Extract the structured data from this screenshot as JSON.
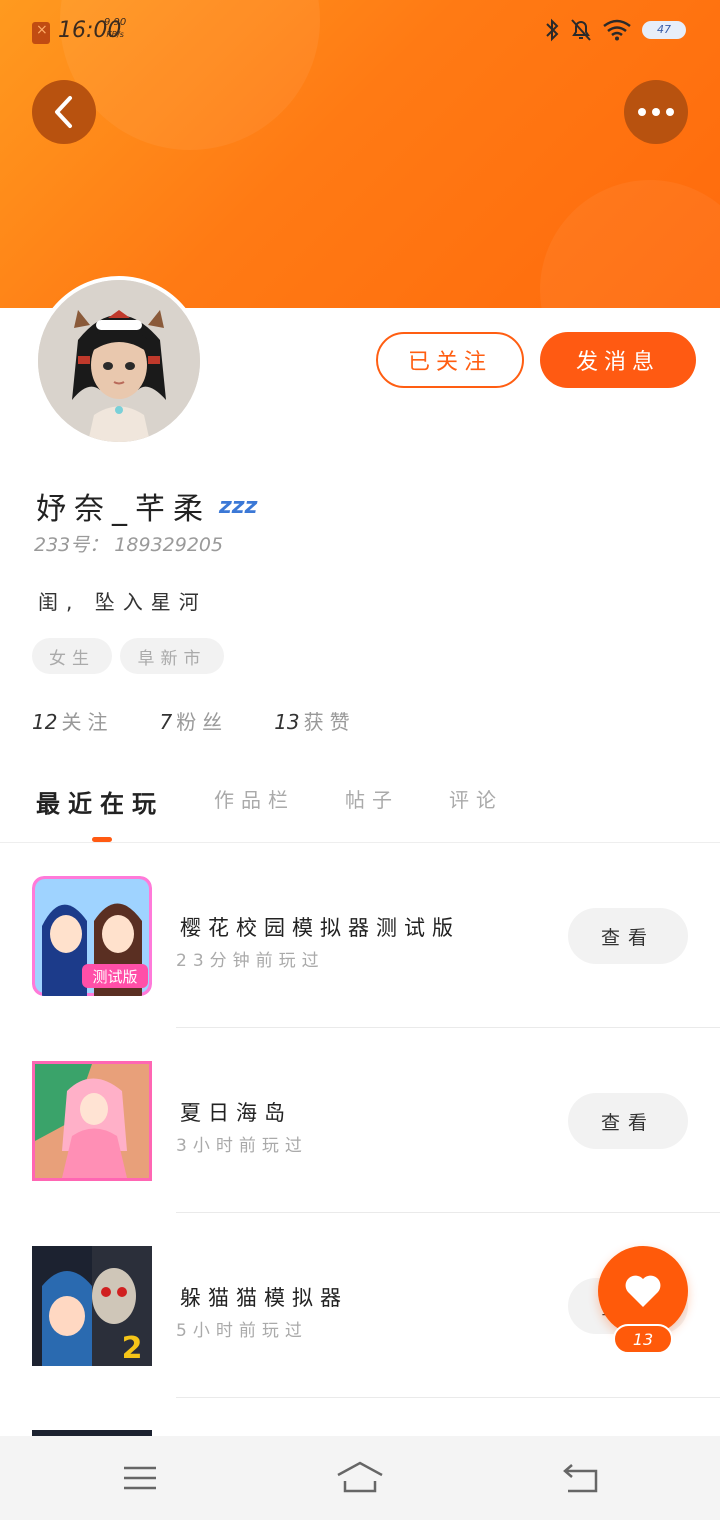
{
  "statusbar": {
    "time": "16:00",
    "speed_value": "9.90",
    "speed_unit": "KB/s",
    "battery": "47"
  },
  "profile": {
    "username": "妤奈_芊柔",
    "zz": "zzz",
    "uid": "233号： 189329205",
    "bio": "闺, 坠入星河",
    "tags": [
      "女生",
      "阜新市"
    ]
  },
  "actions": {
    "follow_label": "已关注",
    "message_label": "发消息"
  },
  "stats": [
    {
      "num": "12",
      "label": "关注"
    },
    {
      "num": "7",
      "label": "粉丝"
    },
    {
      "num": "13",
      "label": "获赞"
    }
  ],
  "tabs": [
    "最近在玩",
    "作品栏",
    "帖子",
    "评论"
  ],
  "games": [
    {
      "title": "樱花校园模拟器测试版",
      "time": "23分钟前玩过",
      "button": "查看",
      "icon_badge": "测试版"
    },
    {
      "title": "夏日海岛",
      "time": "3小时前玩过",
      "button": "查看"
    },
    {
      "title": "躲猫猫模拟器",
      "time": "5小时前玩过",
      "button": "查看",
      "icon_badge": "2"
    }
  ],
  "like": {
    "count": "13"
  },
  "colors": {
    "accent": "#ff5a12",
    "header_top": "#ff9a1f",
    "header_bottom": "#ff6a0c"
  },
  "icons": {
    "back": "chevron-left-icon",
    "more": "more-dots-icon",
    "like": "heart-icon",
    "nav": [
      "menu-icon",
      "home-icon",
      "back-arrow-icon"
    ]
  }
}
